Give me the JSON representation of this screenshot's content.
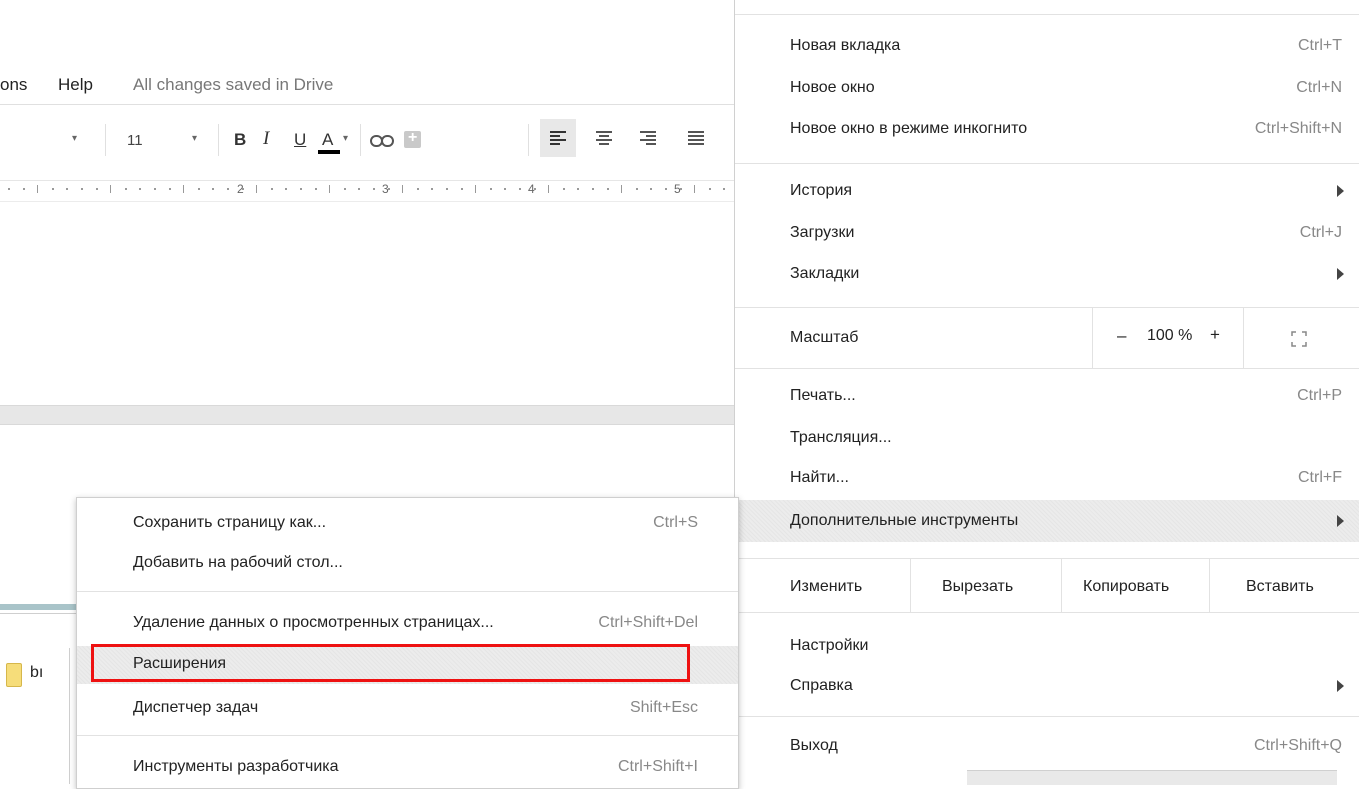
{
  "docs": {
    "menu_partial": "ons",
    "menu_help": "Help",
    "saved_status": "All changes saved in Drive",
    "font_size": "11",
    "bold": "B",
    "italic": "I",
    "underline": "U",
    "text_color": "A",
    "ruler_numbers": [
      "2",
      "3",
      "4",
      "5"
    ],
    "bookmark_text": "bı"
  },
  "main_menu": {
    "new_tab": {
      "label": "Новая вкладка",
      "shortcut": "Ctrl+T"
    },
    "new_window": {
      "label": "Новое окно",
      "shortcut": "Ctrl+N"
    },
    "incognito": {
      "label": "Новое окно в режиме инкогнито",
      "shortcut": "Ctrl+Shift+N"
    },
    "history": {
      "label": "История"
    },
    "downloads": {
      "label": "Загрузки",
      "shortcut": "Ctrl+J"
    },
    "bookmarks": {
      "label": "Закладки"
    },
    "zoom": {
      "label": "Масштаб",
      "minus": "–",
      "value": "100 %",
      "plus": "+"
    },
    "print": {
      "label": "Печать...",
      "shortcut": "Ctrl+P"
    },
    "cast": {
      "label": "Трансляция..."
    },
    "find": {
      "label": "Найти...",
      "shortcut": "Ctrl+F"
    },
    "more_tools": {
      "label": "Дополнительные инструменты"
    },
    "edit": {
      "label": "Изменить",
      "cut": "Вырезать",
      "copy": "Копировать",
      "paste": "Вставить"
    },
    "settings": {
      "label": "Настройки"
    },
    "help": {
      "label": "Справка"
    },
    "exit": {
      "label": "Выход",
      "shortcut": "Ctrl+Shift+Q"
    }
  },
  "submenu": {
    "save_page": {
      "label": "Сохранить страницу как...",
      "shortcut": "Ctrl+S"
    },
    "add_desktop": {
      "label": "Добавить на рабочий стол..."
    },
    "clear_data": {
      "label": "Удаление данных о просмотренных страницах...",
      "shortcut": "Ctrl+Shift+Del"
    },
    "extensions": {
      "label": "Расширения"
    },
    "task_manager": {
      "label": "Диспетчер задач",
      "shortcut": "Shift+Esc"
    },
    "dev_tools": {
      "label": "Инструменты разработчика",
      "shortcut": "Ctrl+Shift+I"
    }
  },
  "colors": {
    "highlight_box": "#ee1111",
    "hover": "#ececec"
  }
}
